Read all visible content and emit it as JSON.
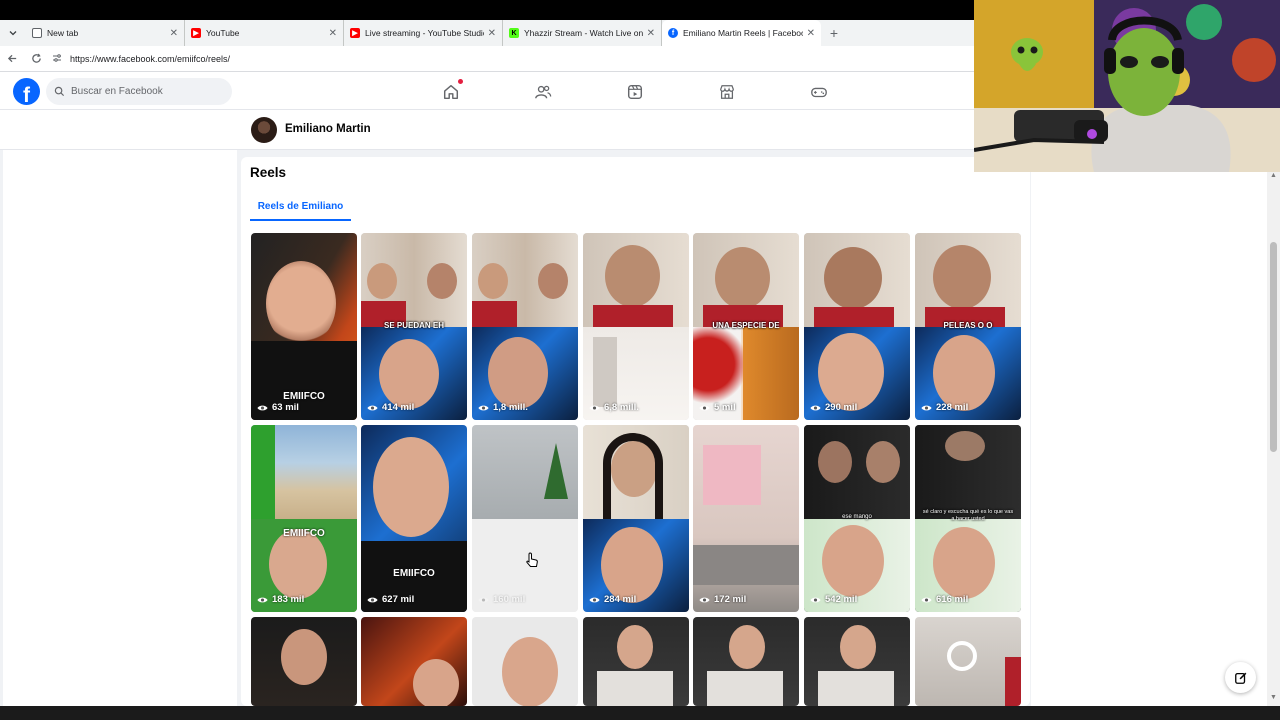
{
  "browser": {
    "tabs": [
      {
        "title": "New tab",
        "favicon_color": "#5f6368",
        "active": false
      },
      {
        "title": "YouTube",
        "favicon_color": "#ff0000",
        "active": false
      },
      {
        "title": "Live streaming - YouTube Studio",
        "favicon_color": "#ff0000",
        "active": false
      },
      {
        "title": "Yhazzir Stream - Watch Live on Kic",
        "favicon_color": "#53fc18",
        "active": false
      },
      {
        "title": "Emiliano Martin Reels | Facebook",
        "favicon_color": "#0866ff",
        "active": true
      }
    ],
    "url": "https://www.facebook.com/emiifco/reels/"
  },
  "facebook": {
    "search_placeholder": "Buscar en Facebook",
    "brand_color": "#0866ff"
  },
  "profile": {
    "name": "Emiliano Martin"
  },
  "reels_section": {
    "title": "Reels",
    "tab_label": "Reels de Emiliano",
    "rows": [
      [
        {
          "views": "63 mil",
          "caption": "",
          "watermark": "EMIIFCO"
        },
        {
          "views": "414 mil",
          "caption": "SE PUEDAN EH",
          "watermark": ""
        },
        {
          "views": "1,8 mill.",
          "caption": "",
          "watermark": ""
        },
        {
          "views": "6,8 mill.",
          "caption": "",
          "watermark": ""
        },
        {
          "views": "5 mil",
          "caption": "UNA ESPECIE DE",
          "watermark": ""
        },
        {
          "views": "290 mil",
          "caption": "",
          "watermark": ""
        },
        {
          "views": "228 mil",
          "caption": "PELEAS O O",
          "watermark": ""
        }
      ],
      [
        {
          "views": "183 mil",
          "caption": "",
          "watermark": "EMIIFCO"
        },
        {
          "views": "627 mil",
          "caption": "",
          "watermark": "EMIIFCO"
        },
        {
          "views": "160 mil",
          "caption": "",
          "watermark": ""
        },
        {
          "views": "284 mil",
          "caption": "",
          "watermark": ""
        },
        {
          "views": "172 mil",
          "caption": "",
          "watermark": ""
        },
        {
          "views": "542 mil",
          "caption": "ese mango",
          "watermark": ""
        },
        {
          "views": "616 mil",
          "caption": "sé claro y escucha qué es lo que vas a hacer usted",
          "watermark": ""
        }
      ],
      [
        {
          "views": "",
          "caption": "",
          "watermark": ""
        },
        {
          "views": "",
          "caption": "",
          "watermark": ""
        },
        {
          "views": "",
          "caption": "",
          "watermark": ""
        },
        {
          "views": "",
          "caption": "",
          "watermark": ""
        },
        {
          "views": "",
          "caption": "",
          "watermark": ""
        },
        {
          "views": "",
          "caption": "",
          "watermark": ""
        },
        {
          "views": "",
          "caption": "",
          "watermark": ""
        }
      ]
    ]
  }
}
